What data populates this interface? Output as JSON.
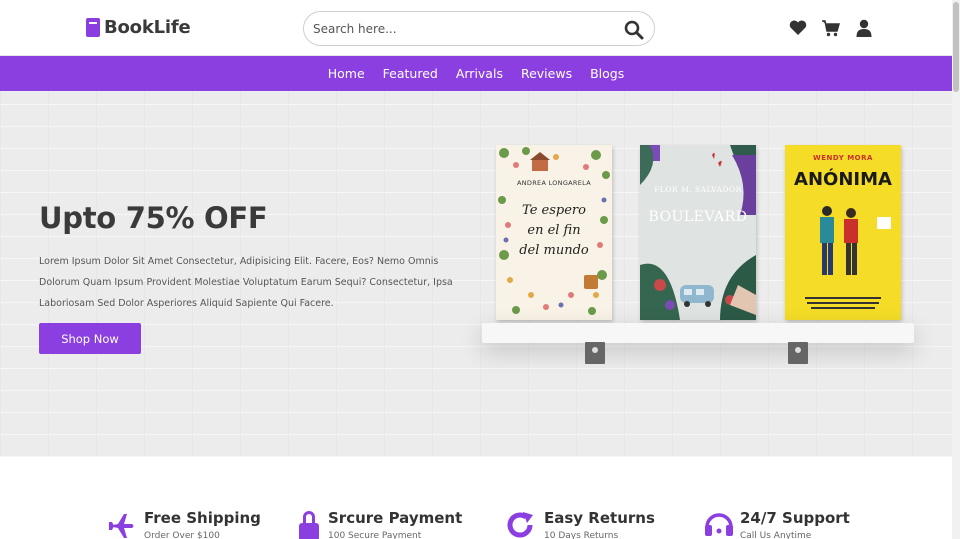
{
  "brand": {
    "name": "BookLife",
    "accent": "#8b3fe1"
  },
  "search": {
    "placeholder": "Search here..."
  },
  "header_icons": [
    "heart-icon",
    "cart-icon",
    "user-icon"
  ],
  "nav": {
    "items": [
      "Home",
      "Featured",
      "Arrivals",
      "Reviews",
      "Blogs"
    ]
  },
  "hero": {
    "title": "Upto 75% OFF",
    "description": "Lorem Ipsum Dolor Sit Amet Consectetur, Adipisicing Elit. Facere, Eos? Nemo Omnis Dolorum Quam Ipsum Provident Molestiae Voluptatum Earum Sequi? Consectetur, Ipsa Laboriosam Sed Dolor Asperiores Aliquid Sapiente Qui Facere.",
    "button": "Shop Now",
    "books": [
      {
        "author": "ANDREA LONGARELA",
        "title_lines": [
          "Te espero",
          "en el fin",
          "del mundo"
        ]
      },
      {
        "author": "FLOR M. SALVADOR",
        "title_lines": [
          "BOULEVARD"
        ]
      },
      {
        "author": "WENDY MORA",
        "title_lines": [
          "ANÓNIMA"
        ]
      }
    ]
  },
  "features": [
    {
      "icon": "plane-icon",
      "title": "Free Shipping",
      "subtitle": "Order Over $100"
    },
    {
      "icon": "lock-icon",
      "title": "Srcure Payment",
      "subtitle": "100 Secure Payment"
    },
    {
      "icon": "redo-icon",
      "title": "Easy Returns",
      "subtitle": "10 Days Returns"
    },
    {
      "icon": "headset-icon",
      "title": "24/7 Support",
      "subtitle": "Call Us Anytime"
    }
  ]
}
